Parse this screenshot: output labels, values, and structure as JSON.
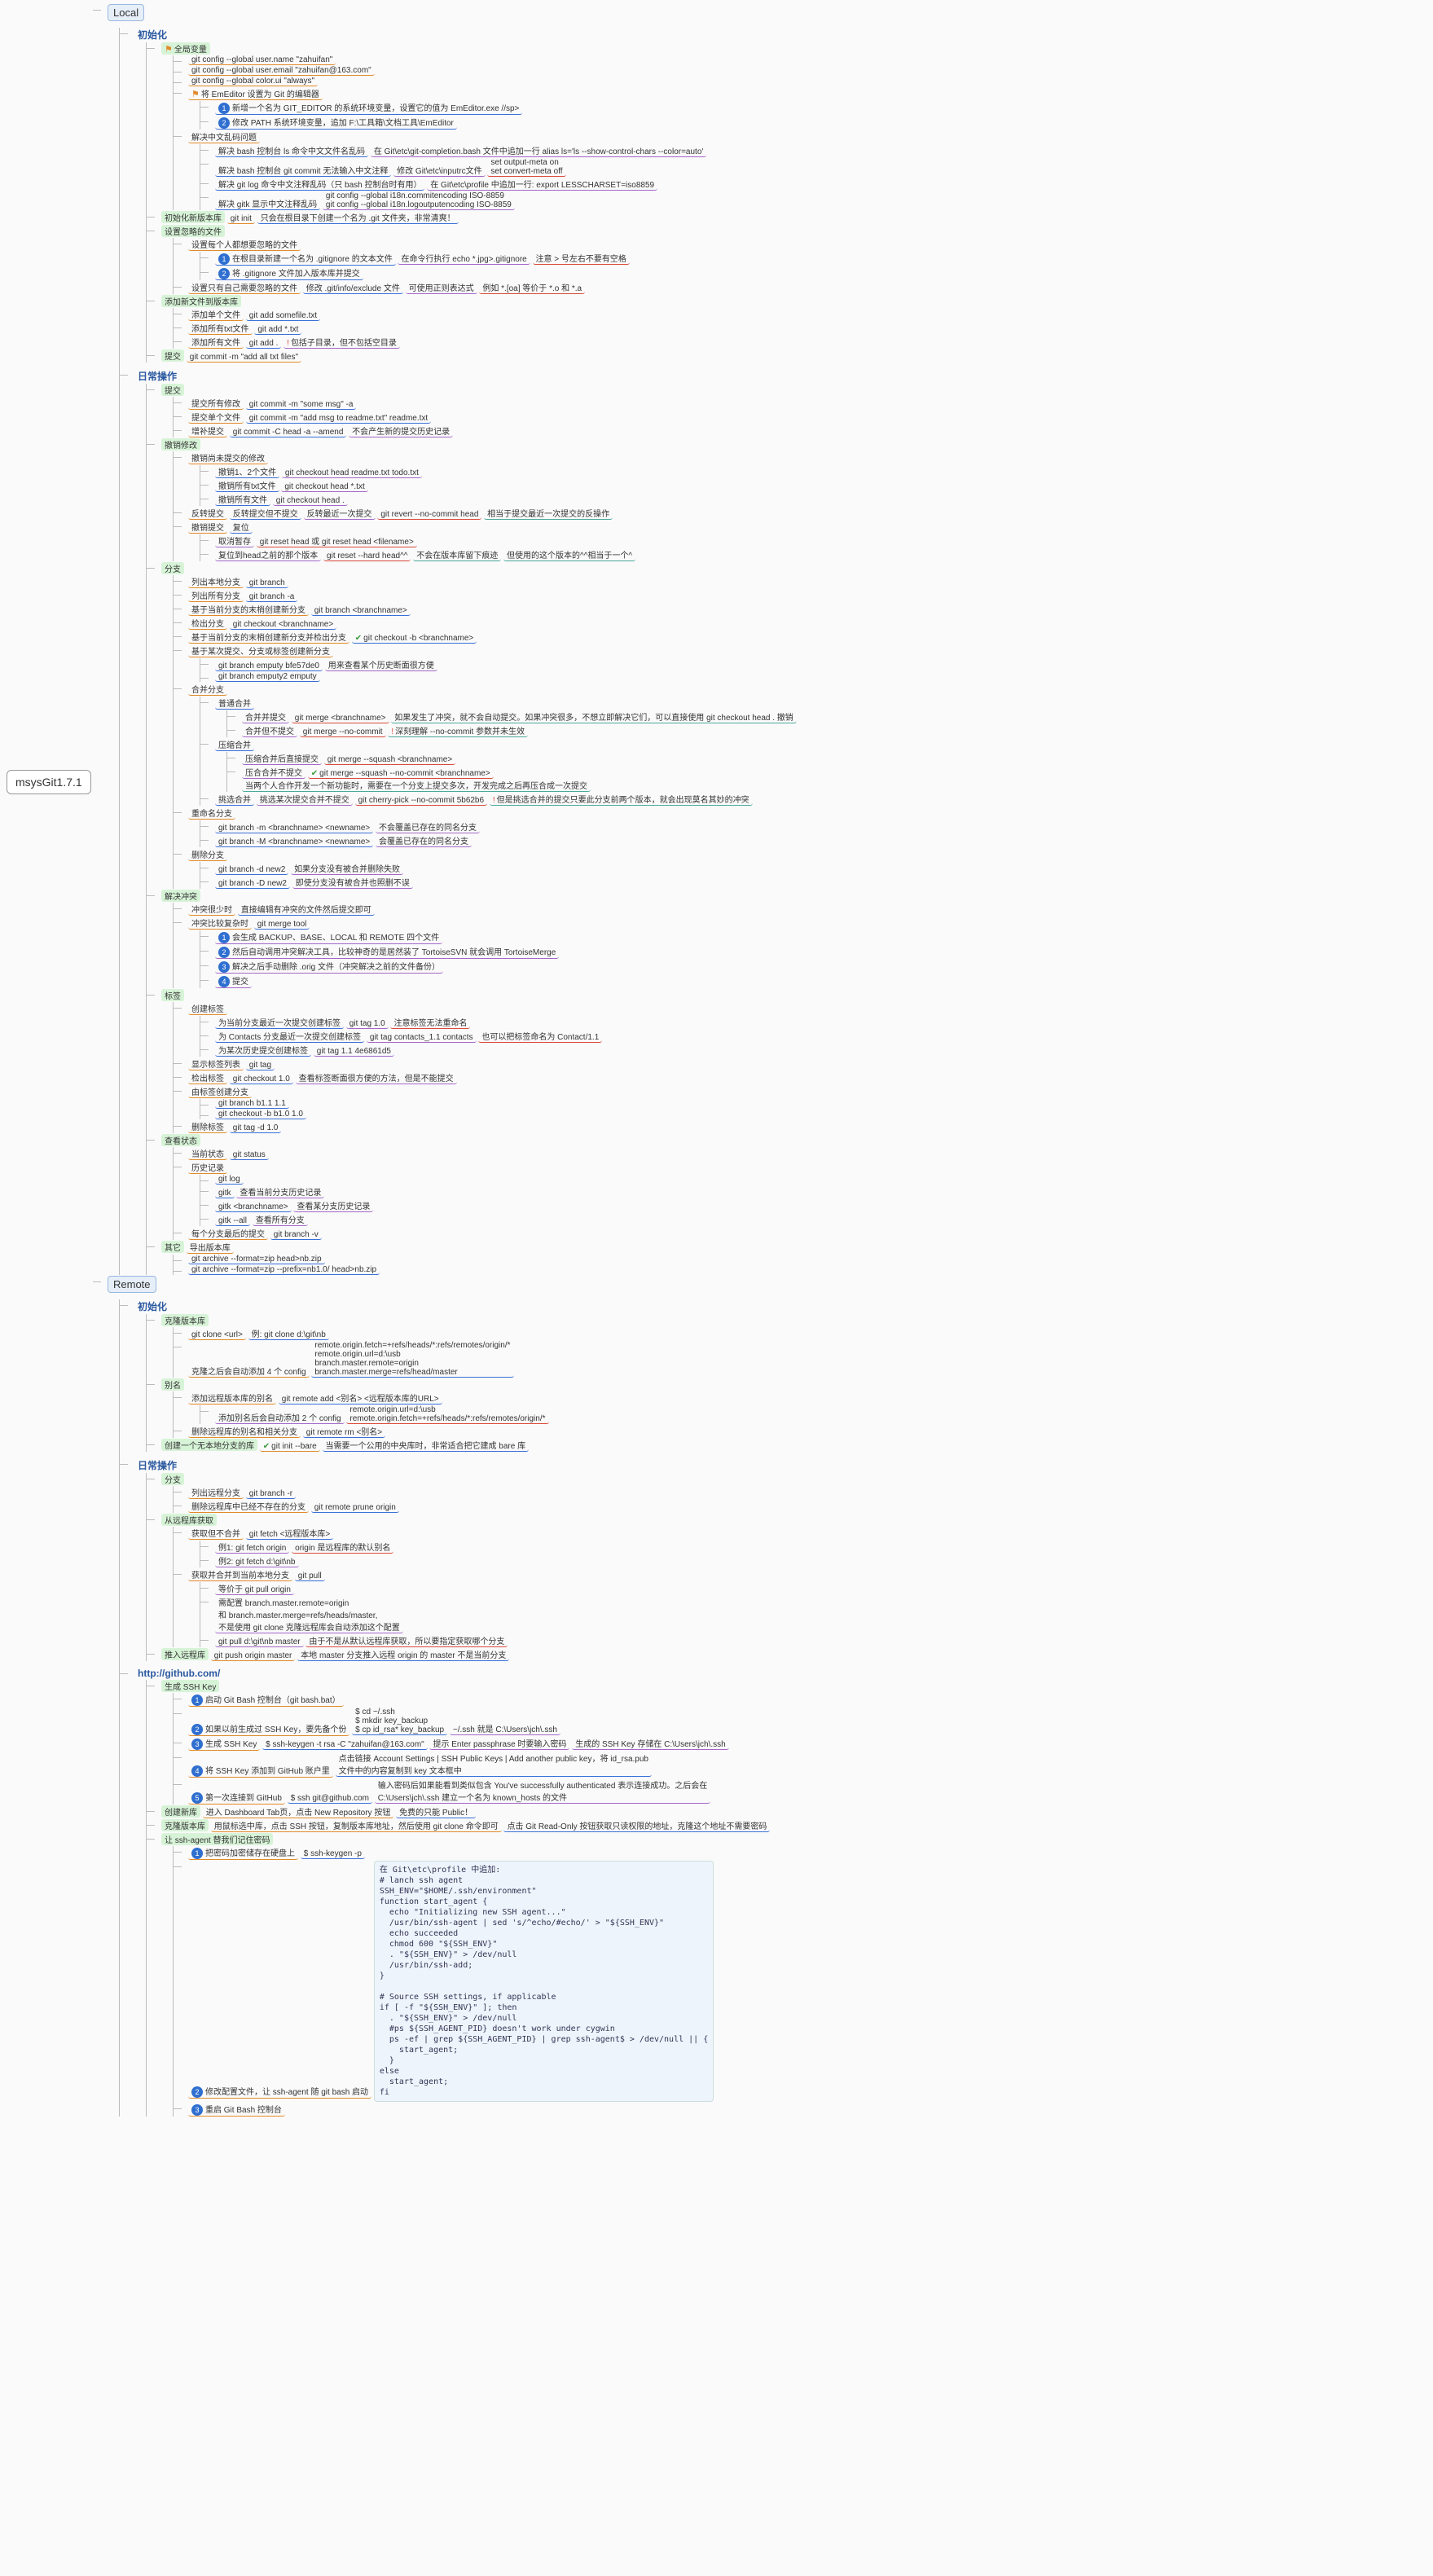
{
  "root": "msysGit1.7.1",
  "local": {
    "title": "Local",
    "init": {
      "title": "初始化",
      "global": {
        "title": "全局变量",
        "cmds": [
          "git config --global user.name \"zahuifan\"",
          "git config --global user.email \"zahuifan@163.com\"",
          "git config --global color.ui \"always\""
        ],
        "emeditor": {
          "title": "将 EmEditor 设置为 Git 的编辑器",
          "steps": [
            "新增一个名为 GIT_EDITOR 的系统环境变量，设置它的值为 EmEditor.exe //sp>",
            "修改 PATH 系统环境变量，追加 F:\\工具箱\\文档工具\\EmEditor"
          ]
        },
        "cn": {
          "title": "解决中文乱码问题",
          "ls": {
            "l": "解决 bash 控制台 ls 命令中文文件名乱码",
            "r": "在 Git\\etc\\git-completion.bash 文件中追加一行 alias ls='ls --show-control-chars --color=auto'"
          },
          "commit": {
            "l": "解决 bash 控制台 git commit 无法输入中文注释",
            "mid": "修改 Git\\etc\\inputrc文件",
            "r": "set output-meta on\nset convert-meta off"
          },
          "log": {
            "l": "解决 git log 命令中文注释乱码（只 bash 控制台时有用）",
            "r": "在 Git\\etc\\profile 中追加一行: export LESSCHARSET=iso8859"
          },
          "gitk": {
            "l": "解决 gitk 显示中文注释乱码",
            "r": "git config --global i18n.commitencoding ISO-8859\ngit config --global i18n.logoutputencoding ISO-8859"
          }
        }
      },
      "newrepo": {
        "title": "初始化新版本库",
        "cmd": "git init",
        "note": "只会在根目录下创建一个名为 .git 文件夹，非常清爽！"
      },
      "ignore": {
        "title": "设置忽略的文件",
        "all": {
          "l": "设置每个人都想要忽略的文件",
          "steps": [
            "在根目录新建一个名为 .gitignore 的文本文件",
            "将 .gitignore 文件加入版本库并提交"
          ],
          "cmdl": "在命令行执行 echo *.jpg>.gitignore",
          "cmdr": "注意 > 号左右不要有空格"
        },
        "self": {
          "l": "设置只有自己需要忽略的文件",
          "r": "修改 .git/info/exclude 文件",
          "note": "可使用正则表达式",
          "ex": "例如 *.[oa] 等价于 *.o 和 *.a"
        }
      },
      "add": {
        "title": "添加新文件到版本库",
        "one": {
          "l": "添加单个文件",
          "r": "git add somefile.txt"
        },
        "all": {
          "l": "添加所有txt文件",
          "r": "git add *.txt"
        },
        "every": {
          "l": "添加所有文件",
          "r": "git add .",
          "note": "包括子目录，但不包括空目录"
        }
      },
      "commit": {
        "title": "提交",
        "cmd": "git commit -m \"add all txt files\""
      }
    },
    "daily": {
      "title": "日常操作",
      "commit": {
        "title": "提交",
        "all": {
          "l": "提交所有修改",
          "r": "git commit -m \"some msg\" -a"
        },
        "one": {
          "l": "提交单个文件",
          "r": "git commit -m \"add msg to readme.txt\" readme.txt"
        },
        "amend": {
          "l": "增补提交",
          "r": "git commit -C head -a --amend",
          "note": "不会产生新的提交历史记录"
        }
      },
      "undo": {
        "title": "撤销修改",
        "unstaged": {
          "title": "撤销尚未提交的修改",
          "p12": {
            "l": "撤销1、2个文件",
            "r": "git checkout head readme.txt todo.txt"
          },
          "ptxt": {
            "l": "撤销所有txt文件",
            "r": "git checkout head *.txt"
          },
          "pall": {
            "l": "撤销所有文件",
            "r": "git checkout head ."
          }
        },
        "revert": {
          "title": "反转提交",
          "l": "反转提交但不提交",
          "r": "反转最近一次提交",
          "cmd": "git revert --no-commit head",
          "note": "相当于提交最近一次提交的反操作"
        },
        "reset": {
          "title": "撤销提交",
          "sub": "复位",
          "soft": {
            "l": "取消暂存",
            "r": "git reset head 或 git reset head <filename>"
          },
          "hard": {
            "l": "复位到head之前的那个版本",
            "r": "git reset --hard head^^",
            "n1": "不会在版本库留下痕迹",
            "n2": "但使用的这个版本的^^相当于一个^"
          }
        }
      },
      "branch": {
        "title": "分支",
        "list": {
          "l": "列出本地分支",
          "r": "git branch"
        },
        "listall": {
          "l": "列出所有分支",
          "r": "git branch -a"
        },
        "newcur": {
          "l": "基于当前分支的末梢创建新分支",
          "r": "git branch <branchname>"
        },
        "co": {
          "l": "检出分支",
          "r": "git checkout <branchname>"
        },
        "newco": {
          "l": "基于当前分支的末梢创建新分支并检出分支",
          "r": "git checkout -b <branchname>"
        },
        "newfrom": {
          "l": "基于某次提交、分支或标签创建新分支",
          "a": {
            "r": "git branch emputy bfe57de0",
            "n": "用来查看某个历史断面很方便"
          },
          "b": {
            "r": "git branch emputy2 emputy"
          }
        },
        "merge": {
          "title": "合并分支",
          "normal": {
            "title": "普通合并",
            "a": {
              "l": "合并并提交",
              "r": "git merge <branchname>",
              "n": "如果发生了冲突，就不会自动提交。如果冲突很多，不想立即解决它们，可以直接使用 git checkout head . 撤销"
            },
            "b": {
              "l": "合并但不提交",
              "r": "git merge --no-commit",
              "n": "深刻理解 --no-commit 参数并未生效"
            }
          },
          "squash": {
            "title": "压缩合并",
            "a": {
              "l": "压缩合并后直接提交",
              "r": "git merge --squash <branchname>"
            },
            "b": {
              "l": "压合合并不提交",
              "r": "git merge --squash --no-commit <branchname>",
              "n": "当两个人合作开发一个新功能时，需要在一个分支上提交多次，开发完成之后再压合成一次提交"
            }
          },
          "pick": {
            "title": "挑选合并",
            "l": "挑选某次提交合并不提交",
            "r": "git cherry-pick --no-commit 5b62b6",
            "n": "但是挑选合并的提交只要此分支前两个版本，就会出现莫名其妙的冲突"
          }
        },
        "rename": {
          "title": "重命名分支",
          "a": {
            "l": "git branch -m <branchname> <newname>",
            "r": "不会覆盖已存在的同名分支"
          },
          "b": {
            "l": "git branch -M <branchname> <newname>",
            "r": "会覆盖已存在的同名分支"
          }
        },
        "del": {
          "title": "删除分支",
          "a": {
            "l": "git branch -d new2",
            "r": "如果分支没有被合并删除失败"
          },
          "b": {
            "l": "git branch -D new2",
            "r": "即使分支没有被合并也照删不误"
          }
        }
      },
      "conflict": {
        "title": "解决冲突",
        "few": {
          "l": "冲突很少时",
          "r": "直接编辑有冲突的文件然后提交即可"
        },
        "many": {
          "l": "冲突比较复杂时",
          "cmd": "git merge tool",
          "s": [
            "会生成 BACKUP、BASE、LOCAL 和 REMOTE 四个文件",
            "然后自动调用冲突解决工具，比较神奇的是居然装了 TortoiseSVN 就会调用 TortoiseMerge",
            "解决之后手动删除 .orig 文件（冲突解决之前的文件备份）",
            "提交"
          ]
        }
      },
      "tag": {
        "title": "标签",
        "new": {
          "title": "创建标签",
          "a": {
            "l": "为当前分支最近一次提交创建标签",
            "r": "git tag 1.0",
            "n": "注意标签无法重命名"
          },
          "b": {
            "l": "为 Contacts 分支最近一次提交创建标签",
            "r": "git tag contacts_1.1 contacts",
            "n": "也可以把标签命名为 Contact/1.1"
          },
          "c": {
            "l": "为某次历史提交创建标签",
            "r": "git tag 1.1 4e6861d5"
          }
        },
        "show": {
          "l": "显示标签列表",
          "r": "git tag"
        },
        "co": {
          "l": "检出标签",
          "r": "git checkout 1.0",
          "n": "查看标签断面很方便的方法，但是不能提交"
        },
        "tob": {
          "title": "由标签创建分支",
          "a": "git branch b1.1 1.1",
          "b": "git checkout -b b1.0 1.0"
        },
        "del": {
          "l": "删除标签",
          "r": "git tag -d 1.0"
        }
      },
      "status": {
        "title": "查看状态",
        "cur": {
          "l": "当前状态",
          "r": "git status"
        },
        "hist": {
          "title": "历史记录",
          "log": "git log",
          "a": {
            "l": "gitk",
            "r": "查看当前分支历史记录"
          },
          "b": {
            "l": "gitk <branchname>",
            "r": "查看某分支历史记录"
          },
          "c": {
            "l": "gitk --all",
            "r": "查看所有分支"
          }
        },
        "eachlast": {
          "l": "每个分支最后的提交",
          "r": "git branch -v"
        }
      },
      "other": {
        "title": "其它",
        "sub": "导出版本库",
        "a": "git archive --format=zip head>nb.zip",
        "b": "git archive --format=zip --prefix=nb1.0/ head>nb.zip"
      }
    }
  },
  "remote": {
    "title": "Remote",
    "init": {
      "title": "初始化",
      "clone": {
        "title": "克隆版本库",
        "cmd": "git clone <url>",
        "ex": "例: git clone d:\\git\\nb",
        "cfg": {
          "l": "克隆之后会自动添加 4 个 config",
          "r": "remote.origin.fetch=+refs/heads/*:refs/remotes/origin/*\nremote.origin.url=d:\\usb\nbranch.master.remote=origin\nbranch.master.merge=refs/head/master"
        }
      },
      "alias": {
        "title": "别名",
        "add": {
          "l": "添加远程版本库的别名",
          "r": "git remote add <别名> <远程版本库的URL>",
          "cfg": {
            "l": "添加别名后会自动添加 2 个 config",
            "r": "remote.origin.url=d:\\usb\nremote.origin.fetch=+refs/heads/*:refs/remotes/origin/*"
          }
        },
        "del": {
          "l": "删除远程库的别名和相关分支",
          "r": "git remote rm <别名>"
        }
      },
      "bare": {
        "l": "创建一个无本地分支的库",
        "r": "git init --bare",
        "n": "当需要一个公用的中央库时，非常适合把它建成 bare 库"
      }
    },
    "daily": {
      "title": "日常操作",
      "branch": {
        "title": "分支",
        "a": {
          "l": "列出远程分支",
          "r": "git branch -r"
        },
        "b": {
          "l": "删除远程库中已经不存在的分支",
          "r": "git remote prune origin"
        }
      },
      "fetch": {
        "title": "从远程库获取",
        "only": {
          "l": "获取但不合并",
          "cmd": "git fetch <远程版本库>",
          "a": "例1: git fetch origin",
          "an": "origin 是远程库的默认别名",
          "b": "例2: git fetch d:\\git\\nb"
        },
        "pull": {
          "l": "获取并合并到当前本地分支",
          "cmd": "git pull",
          "eq": "等价于 git pull origin",
          "c": "需配置 branch.master.remote=origin\n和 branch.master.merge=refs/heads/master,\n不是使用 git clone 克隆远程库会自动添加这个配置",
          "d": {
            "l": "git pull d:\\git\\nb master",
            "r": "由于不是从默认远程库获取，所以要指定获取哪个分支"
          }
        }
      },
      "push": {
        "title": "推入远程库",
        "cmd": "git push origin master",
        "n": "本地 master 分支推入远程 origin 的 master 不是当前分支"
      }
    },
    "github": {
      "title": "http://github.com/",
      "ssh": {
        "title": "生成 SSH Key",
        "s1": {
          "l": "启动 Git Bash 控制台（git bash.bat）"
        },
        "s2": {
          "l": "如果以前生成过 SSH Key，要先备个份",
          "r": "$ cd ~/.ssh\n$ mkdir key_backup\n$ cp id_rsa* key_backup",
          "n": "~/.ssh 就是 C:\\Users\\jch\\.ssh"
        },
        "s3": {
          "l": "生成 SSH Key",
          "r": "$ ssh-keygen -t rsa -C \"zahuifan@163.com\"",
          "n1": "提示 Enter passphrase 时要输入密码",
          "n2": "生成的 SSH Key 存储在 C:\\Users\\jch\\.ssh"
        },
        "s4": {
          "l": "将 SSH Key 添加到 GitHub 账户里",
          "r": "点击链接 Account Settings | SSH Public Keys | Add another public key，将 id_rsa.pub\n文件中的内容复制到 key 文本框中"
        },
        "s5": {
          "l": "第一次连接到 GitHub",
          "r": "$ ssh git@github.com",
          "n": "输入密码后如果能看到类似包含 You've successfully authenticated 表示连接成功。之后会在\nC:\\Users\\jch\\.ssh 建立一个名为 known_hosts 的文件"
        }
      },
      "newrepo": {
        "title": "创建新库",
        "l": "进入 Dashboard Tab页，点击 New Repository 按钮",
        "r": "免费的只能 Public！"
      },
      "clone": {
        "title": "克隆版本库",
        "l": "用鼠标选中库，点击 SSH 按钮，复制版本库地址，然后使用 git clone 命令即可",
        "r": "点击 Git Read-Only 按钮获取只读权限的地址，克隆这个地址不需要密码"
      },
      "agent": {
        "title": "让 ssh-agent 替我们记住密码",
        "s1": {
          "l": "把密码加密储存在硬盘上",
          "r": "$ ssh-keygen -p"
        },
        "s2": {
          "l": "修改配置文件，让 ssh-agent 随 git bash 启动",
          "code": "在 Git\\etc\\profile 中追加:\n# lanch ssh agent\nSSH_ENV=\"$HOME/.ssh/environment\"\nfunction start_agent {\n  echo \"Initializing new SSH agent...\"\n  /usr/bin/ssh-agent | sed 's/^echo/#echo/' > \"${SSH_ENV}\"\n  echo succeeded\n  chmod 600 \"${SSH_ENV}\"\n  . \"${SSH_ENV}\" > /dev/null\n  /usr/bin/ssh-add;\n}\n\n# Source SSH settings, if applicable\nif [ -f \"${SSH_ENV}\" ]; then\n  . \"${SSH_ENV}\" > /dev/null\n  #ps ${SSH_AGENT_PID} doesn't work under cygwin\n  ps -ef | grep ${SSH_AGENT_PID} | grep ssh-agent$ > /dev/null || {\n    start_agent;\n  }\nelse\n  start_agent;\nfi"
        },
        "s3": {
          "l": "重启 Git Bash 控制台"
        }
      }
    }
  }
}
